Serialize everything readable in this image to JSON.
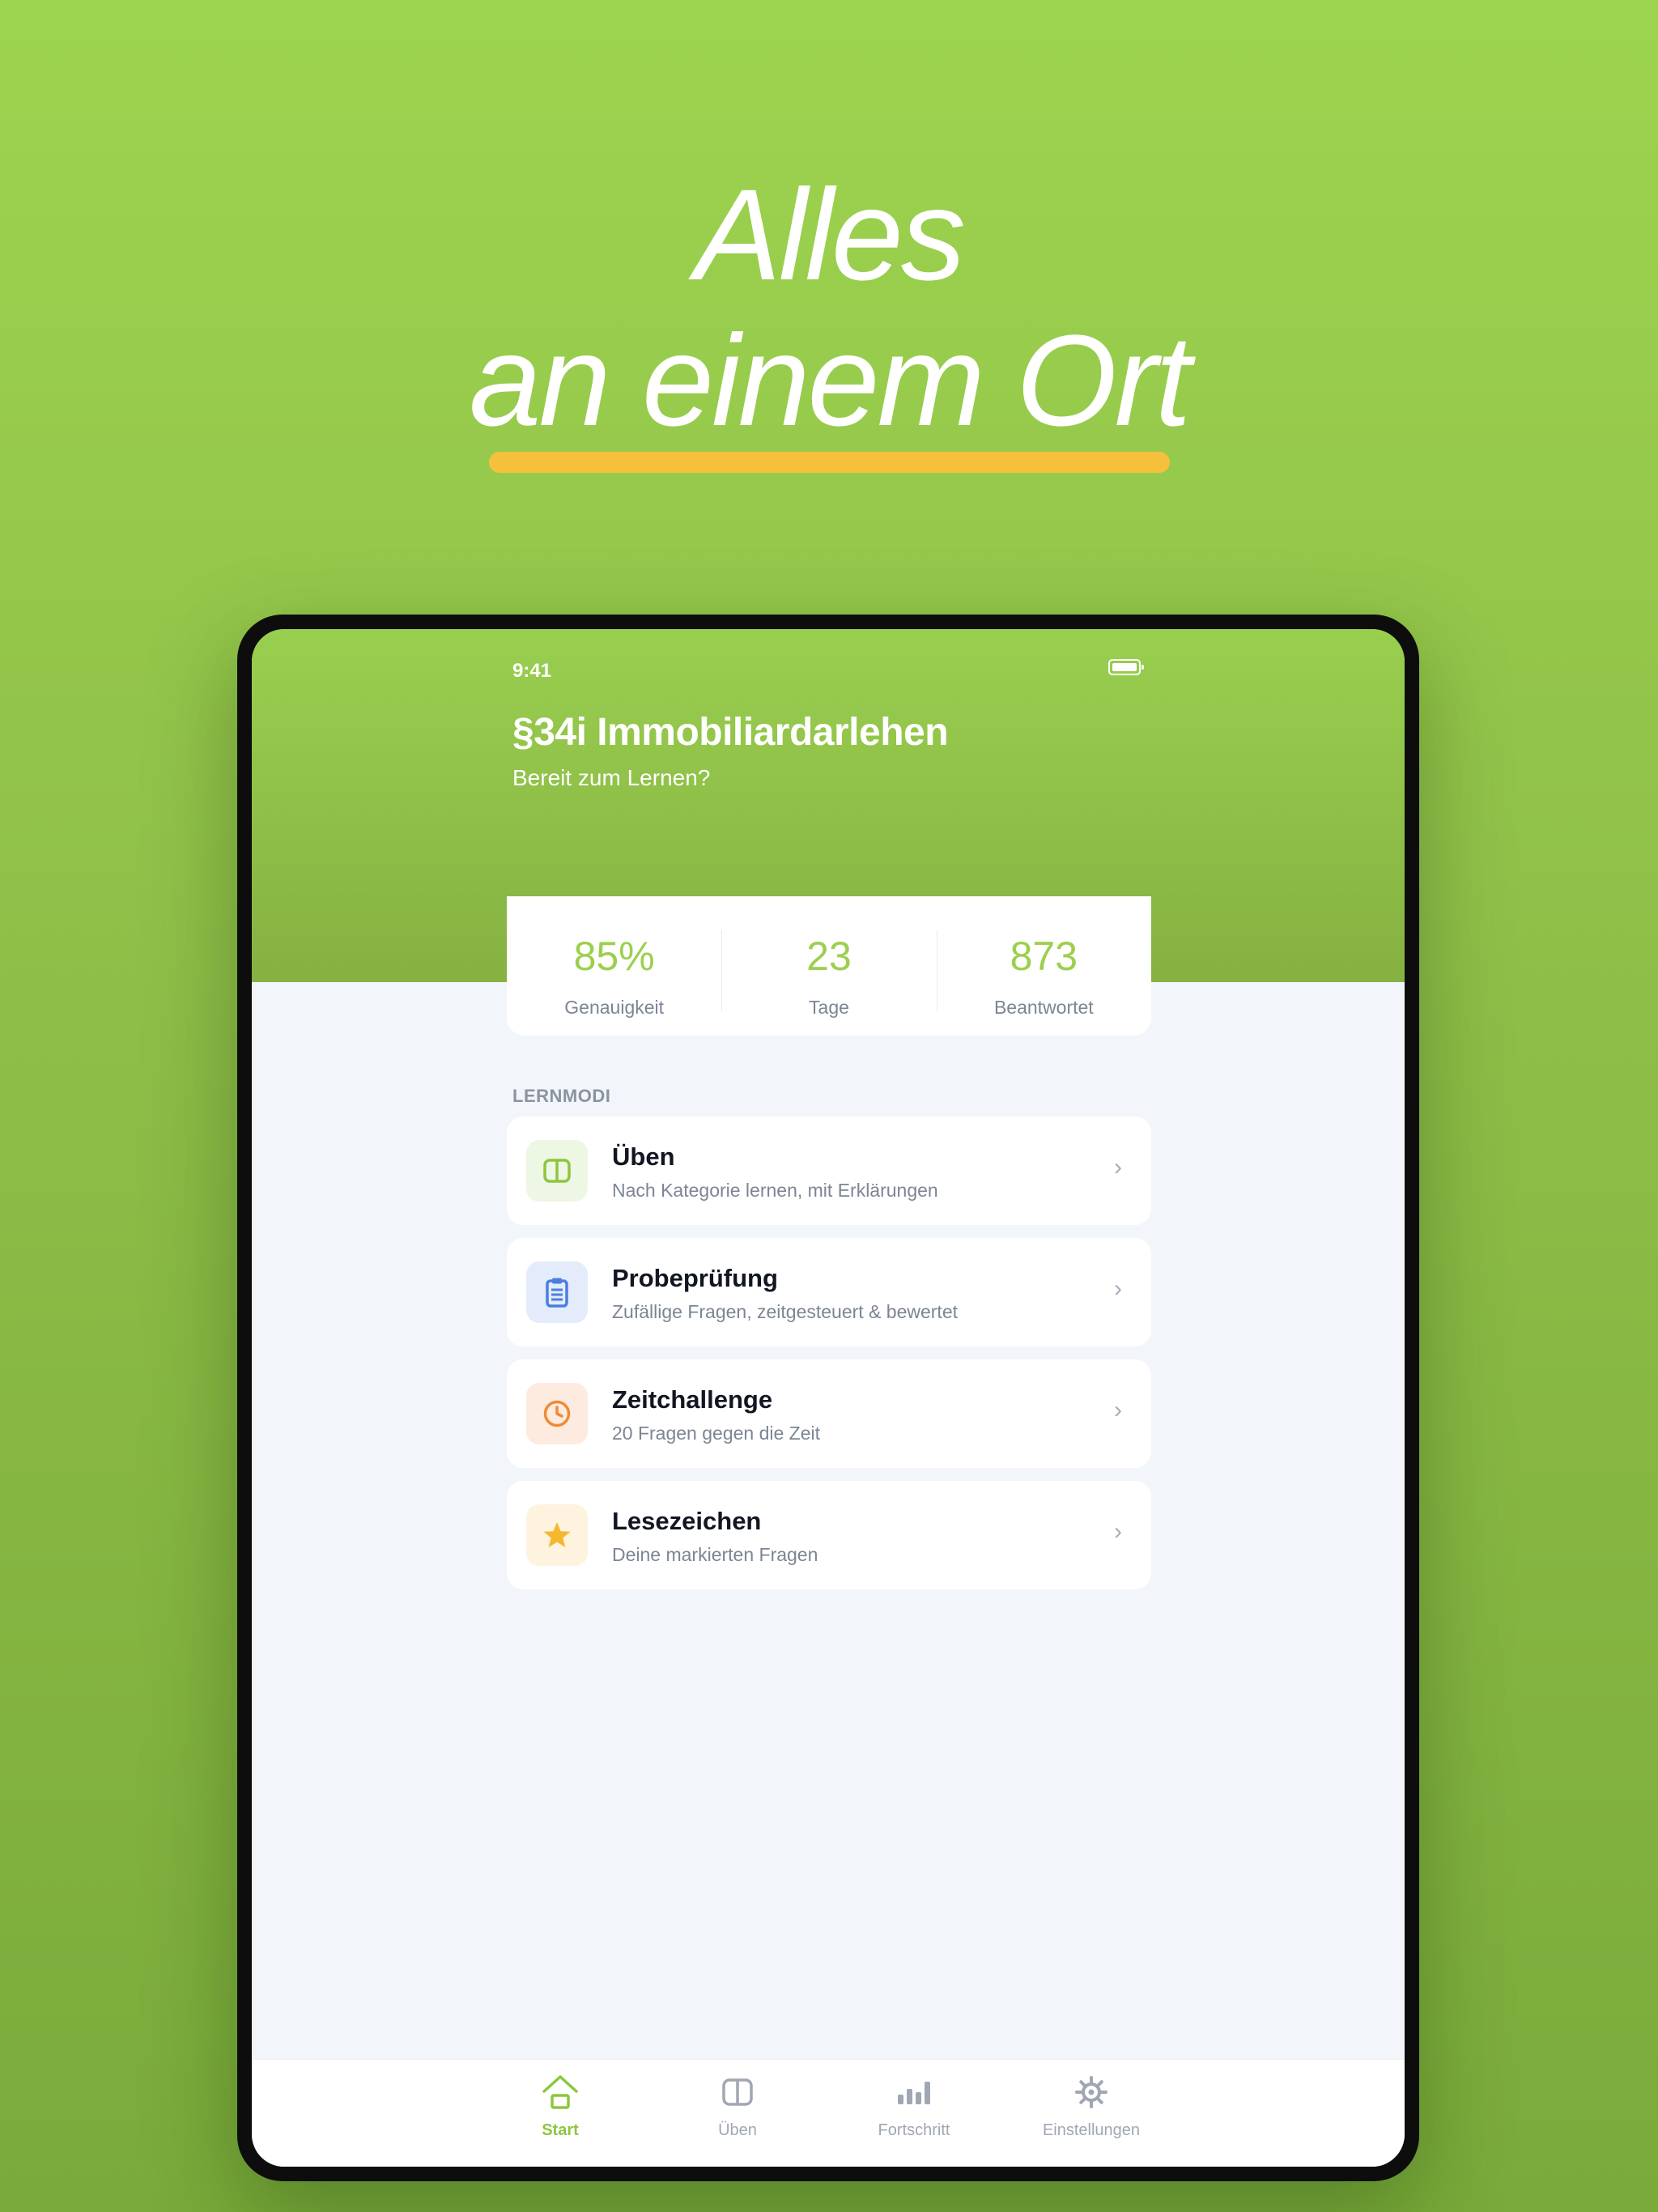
{
  "headline": {
    "line1": "Alles",
    "line2": "an einem Ort"
  },
  "status_bar": {
    "time": "9:41",
    "battery_icon": "battery-full-icon"
  },
  "header": {
    "title": "§34i Immobiliardarlehen",
    "subtitle": "Bereit zum Lernen?"
  },
  "stats": [
    {
      "value": "85%",
      "label": "Genauigkeit"
    },
    {
      "value": "23",
      "label": "Tage"
    },
    {
      "value": "873",
      "label": "Beantwortet"
    }
  ],
  "modes_section": {
    "label": "LERNMODI",
    "items": [
      {
        "title": "Üben",
        "description": "Nach Kategorie lernen, mit Erklärungen",
        "icon": "book-icon",
        "icon_color": "#8cc63f",
        "icon_bg": "#eef6e4"
      },
      {
        "title": "Probeprüfung",
        "description": "Zufällige Fragen, zeitgesteuert & bewertet",
        "icon": "clipboard-icon",
        "icon_color": "#4a7fe0",
        "icon_bg": "#e4ecfb"
      },
      {
        "title": "Zeitchallenge",
        "description": "20 Fragen gegen die Zeit",
        "icon": "clock-icon",
        "icon_color": "#f08a35",
        "icon_bg": "#fdebdf"
      },
      {
        "title": "Lesezeichen",
        "description": "Deine markierten Fragen",
        "icon": "star-icon",
        "icon_color": "#f5b82e",
        "icon_bg": "#fdf3de"
      }
    ],
    "chevron": "›"
  },
  "tabbar": {
    "tabs": [
      {
        "label": "Start",
        "icon": "home-icon",
        "active": true
      },
      {
        "label": "Üben",
        "icon": "book-icon",
        "active": false
      },
      {
        "label": "Fortschritt",
        "icon": "bar-chart-icon",
        "active": false
      },
      {
        "label": "Einstellungen",
        "icon": "gear-icon",
        "active": false
      }
    ]
  },
  "colors": {
    "brand_green": "#9ccf4e",
    "highlight_yellow": "#f5c13d",
    "background": "#f2f5fa"
  }
}
